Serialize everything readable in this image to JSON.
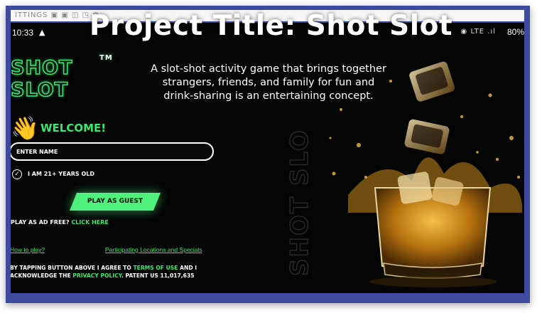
{
  "phone": {
    "top_strip_text": "ITTINGS  ▣ ▣ ◫ ◳   ⚙",
    "time": "10:33",
    "status_icons": "◉ LTE .ıl",
    "battery": "80%"
  },
  "slide": {
    "title": "Project Title: Shot Slot",
    "description": "A slot-shot activity game that brings together strangers, friends, and family for fun and drink-sharing is an entertaining concept."
  },
  "app": {
    "logo_text": "SHOT SLOT",
    "logo_tm": "TM",
    "welcome_text": "WELCOME!",
    "name_placeholder": "ENTER NAME",
    "age_label": "I AM 21+ YEARS OLD",
    "age_checked": true,
    "play_button": "PLAY AS GUEST",
    "adfree_label": "PLAY AS AD FREE?",
    "click_here": "CLICK HERE",
    "how_to_play": "How to play?",
    "locations_link": "Participating Locations and Specials",
    "legal_1": "BY TAPPING BUTTON ABOVE I AGREE TO ",
    "terms_link": "TERMS OF USE",
    "legal_2": " AND I ACKNOWLEDGE THE ",
    "privacy_link": "PRIVACY POLICY",
    "legal_3": ". PATENT US 11,017,635",
    "side_logo_text": "SHOT SLOT"
  },
  "icons": {
    "warning": "warning-icon",
    "wave": "waving-hand-icon",
    "check": "check-circle-icon"
  },
  "colors": {
    "accent_green": "#39e86f",
    "button_green": "#4ff07c",
    "frame_blue": "#3d4a9e",
    "screen_bg": "#050505"
  }
}
